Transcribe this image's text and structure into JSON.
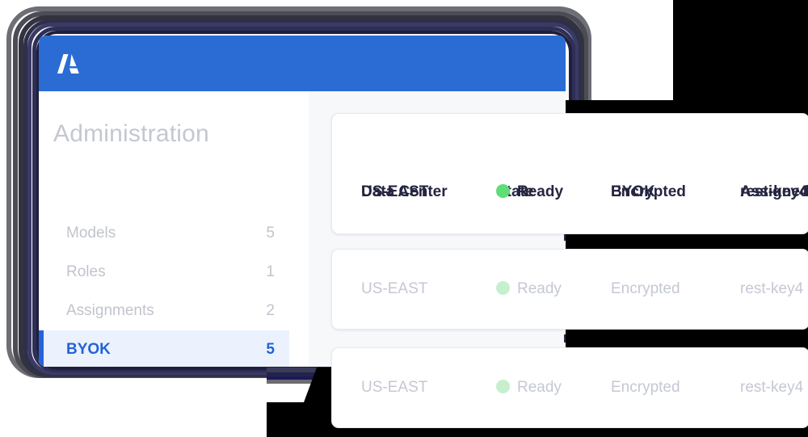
{
  "window": {
    "titlebar": {
      "logo_icon": "appdynamics-a-logo-icon",
      "accent_color": "#2a6cd4"
    }
  },
  "sidebar": {
    "title": "Administration",
    "items": [
      {
        "label": "Models",
        "count": "5",
        "active": false
      },
      {
        "label": "Roles",
        "count": "1",
        "active": false
      },
      {
        "label": "Assignments",
        "count": "2",
        "active": false
      },
      {
        "label": "BYOK",
        "count": "5",
        "active": true
      }
    ],
    "active_color": "#2463d8",
    "active_bg": "#ebf2fd"
  },
  "table": {
    "headers": [
      "Data Center",
      "State",
      "BYOK",
      "Assigned"
    ],
    "rows": [
      {
        "data_center": "US-EAST",
        "state": "Ready",
        "state_dot": "status-dot-ready",
        "byok": "Encrypted",
        "assigned": "rest-key4"
      },
      {
        "data_center": "US-EAST",
        "state": "Ready",
        "state_dot": "status-dot-ready",
        "byok": "Encrypted",
        "assigned": "rest-key4"
      },
      {
        "data_center": "US-EAST",
        "state": "Ready",
        "state_dot": "status-dot-ready",
        "byok": "Encrypted",
        "assigned": "rest-key4"
      }
    ],
    "status_color": "#5fdd76"
  }
}
